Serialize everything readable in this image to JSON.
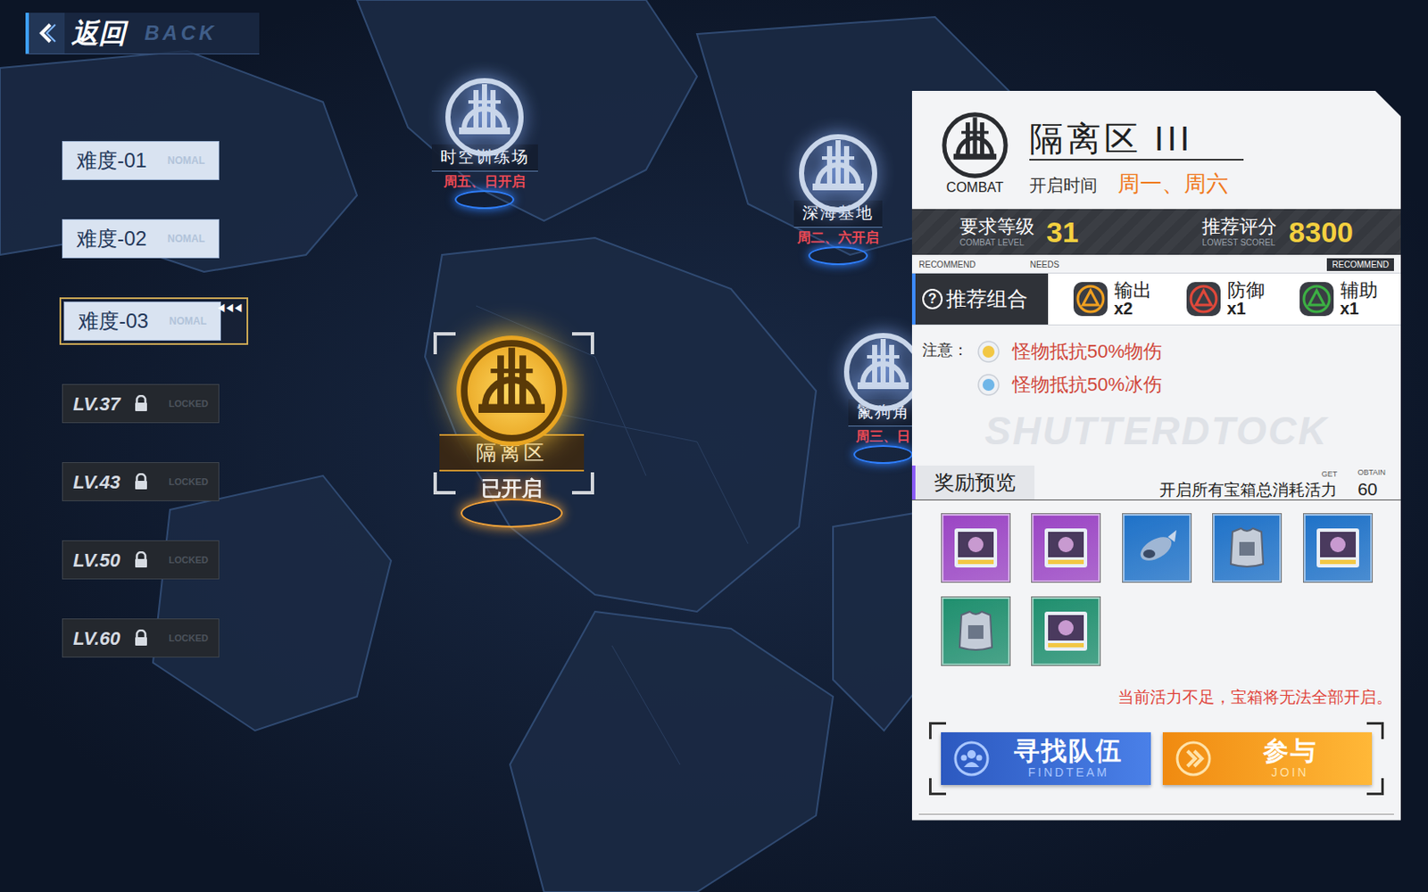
{
  "back": {
    "label": "返回",
    "sub": "BACK"
  },
  "difficulties": [
    {
      "label": "难度-01",
      "tag": "NOMAL",
      "selected": false,
      "locked": false
    },
    {
      "label": "难度-02",
      "tag": "NOMAL",
      "selected": false,
      "locked": false
    },
    {
      "label": "难度-03",
      "tag": "NOMAL",
      "selected": true,
      "locked": false
    },
    {
      "label": "LV.37",
      "tag": "LOCKED",
      "selected": false,
      "locked": true
    },
    {
      "label": "LV.43",
      "tag": "LOCKED",
      "selected": false,
      "locked": true
    },
    {
      "label": "LV.50",
      "tag": "LOCKED",
      "selected": false,
      "locked": true
    },
    {
      "label": "LV.60",
      "tag": "LOCKED",
      "selected": false,
      "locked": true
    }
  ],
  "selected_marker": "◀◀◀",
  "map_nodes": [
    {
      "name": "时空训练场",
      "schedule": "周五、日开启",
      "selected": false
    },
    {
      "name": "深海基地",
      "schedule": "周二、六开启",
      "selected": false
    },
    {
      "name": "隔离区",
      "schedule": "已开启",
      "selected": true
    },
    {
      "name": "鬣狗角",
      "schedule": "周三、日",
      "selected": false
    }
  ],
  "panel": {
    "logo_label": "COMBAT",
    "title": "隔离区 III",
    "open_label": "开启时间",
    "open_days": "周一、周六",
    "level": {
      "label": "要求等级",
      "sub": "COMBAT LEVEL",
      "value": "31"
    },
    "score": {
      "label": "推荐评分",
      "sub": "LOWEST SCOREL",
      "value": "8300"
    },
    "tags": {
      "recommend": "RECOMMEND",
      "needs": "NEEDS",
      "recommend_right": "RECOMMEND"
    },
    "team": {
      "help_icon": "?",
      "label": "推荐组合",
      "roles": [
        {
          "name": "输出",
          "count": "x2",
          "color": "#f0a020"
        },
        {
          "name": "防御",
          "count": "x1",
          "color": "#e0483a"
        },
        {
          "name": "辅助",
          "count": "x1",
          "color": "#3cb043"
        }
      ]
    },
    "notes": {
      "label": "注意：",
      "items": [
        {
          "text": "怪物抵抗50%物伤",
          "color": "#f2c744"
        },
        {
          "text": "怪物抵抗50%冰伤",
          "color": "#6fb6e8"
        }
      ]
    },
    "watermark": "SHUTTERDTOCK",
    "rewards": {
      "label": "奖励预览",
      "get": "GET",
      "obtain": "OBTAIN",
      "cost_label": "开启所有宝箱总消耗活力",
      "cost": "60",
      "items": [
        {
          "kind": "card",
          "color": "#9b45c4"
        },
        {
          "kind": "card",
          "color": "#9b45c4"
        },
        {
          "kind": "part",
          "color": "#1f72c8"
        },
        {
          "kind": "armor",
          "color": "#1f72c8"
        },
        {
          "kind": "card",
          "color": "#1f72c8"
        },
        {
          "kind": "armor",
          "color": "#1f8f6e"
        },
        {
          "kind": "card",
          "color": "#1f8f6e"
        }
      ]
    },
    "warning": "当前活力不足，宝箱将无法全部开启。",
    "buttons": [
      {
        "label": "寻找队伍",
        "sub": "FINDTEAM",
        "kind": "team"
      },
      {
        "label": "参与",
        "sub": "JOIN",
        "kind": "join"
      }
    ]
  }
}
